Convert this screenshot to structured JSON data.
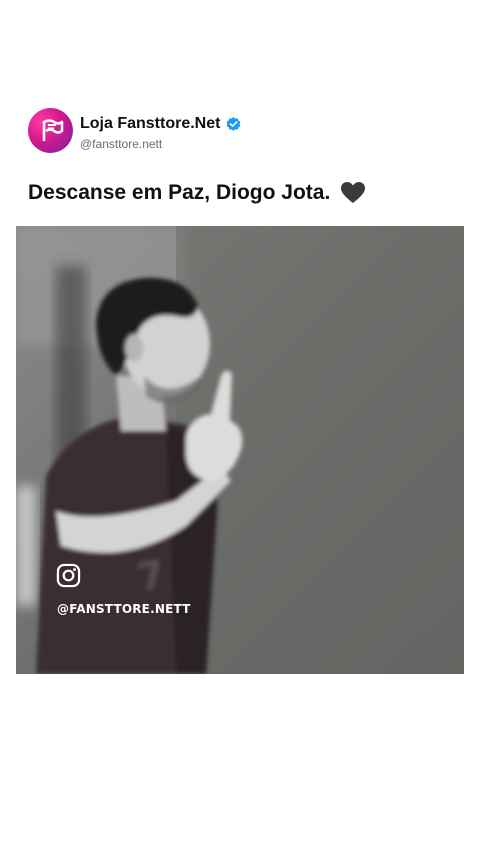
{
  "post": {
    "author": {
      "display_name": "Loja Fansttore.Net",
      "handle": "@fansttore.nett",
      "avatar_icon": "flag-logo-icon",
      "verified": true,
      "verified_color": "#1d9bf0"
    },
    "caption": "Descanse em Paz, Diogo Jota.",
    "caption_emoji": "black-heart-icon",
    "media": {
      "type": "image",
      "overlay": {
        "icon": "instagram-icon",
        "handle": "@FANSTTORE.NETT"
      }
    }
  },
  "colors": {
    "accent": "#d01a8c",
    "accent_dark": "#7a1fa6",
    "text": "#111111",
    "muted": "#6b6b6b"
  }
}
